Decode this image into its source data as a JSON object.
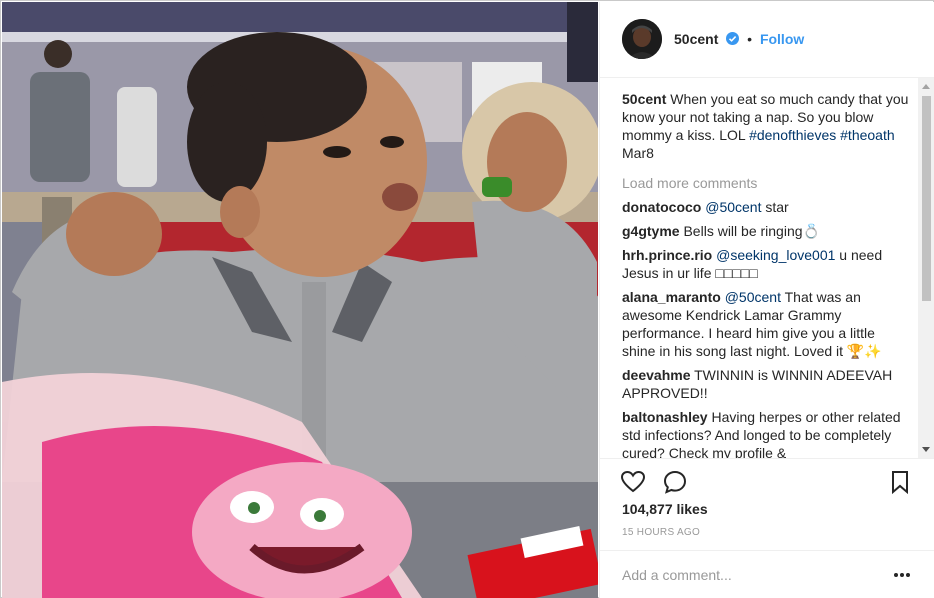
{
  "post": {
    "username": "50cent",
    "follow_label": "Follow",
    "dot": "•",
    "verified_icon": "verified-badge-icon"
  },
  "caption": {
    "username": "50cent",
    "text": "When you eat so much candy that you know your not taking a nap. So you blow mommy a kiss. LOL",
    "tags": [
      "#denofthieves",
      "#theoath"
    ],
    "date": "Mar8"
  },
  "load_more_label": "Load more comments",
  "comments": [
    {
      "user": "donatococo",
      "mention": "@50cent",
      "text": " star"
    },
    {
      "user": "g4gtyme",
      "mention": "",
      "text": "Bells will be ringing💍"
    },
    {
      "user": "hrh.prince.rio",
      "mention": "@seeking_love001",
      "text": " u need Jesus in ur life □□□□□"
    },
    {
      "user": "alana_maranto",
      "mention": "@50cent",
      "text": " That was an awesome Kendrick Lamar Grammy performance. I heard him give you a little shine in his song last night. Loved it 🏆✨"
    },
    {
      "user": "deevahme",
      "mention": "",
      "text": "TWINNIN is WINNIN ADEEVAH APPROVED!!"
    },
    {
      "user": "baltonashley",
      "mention": "",
      "text": "Having herpes or other related std infections? And longed to be completely cured? Check my profile &"
    }
  ],
  "likes": "104,877 likes",
  "time": "15 HOURS AGO",
  "add_comment_placeholder": "Add a comment...",
  "colors": {
    "link": "#003569",
    "follow": "#3897f0",
    "muted": "#999999",
    "verified": "#3897f0"
  },
  "icons": {
    "like": "heart-outline-icon",
    "comment": "speech-bubble-icon",
    "save": "bookmark-icon",
    "more": "more-dots-icon"
  }
}
